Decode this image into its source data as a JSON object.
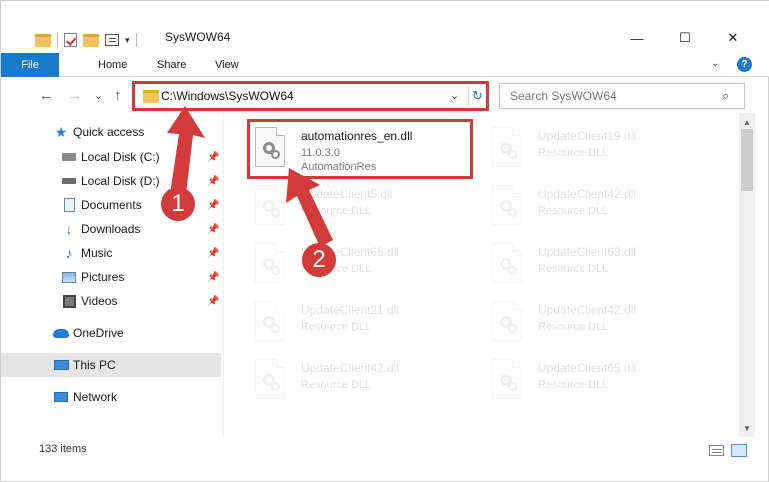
{
  "window": {
    "title": "SysWOW64",
    "minimize": "—",
    "maximize": "☐",
    "close": "✕"
  },
  "ribbon": {
    "tabs": [
      {
        "label": "File"
      },
      {
        "label": "Home"
      },
      {
        "label": "Share"
      },
      {
        "label": "View"
      }
    ],
    "help": "?"
  },
  "navigation": {
    "back": "←",
    "forward": "→",
    "recent": "⌄",
    "up": "↑"
  },
  "address": {
    "path": "C:\\Windows\\SysWOW64",
    "dropdown": "⌄",
    "refresh": "↻"
  },
  "search": {
    "placeholder": "Search SysWOW64",
    "icon": "search-icon"
  },
  "sidebar": {
    "items": [
      {
        "label": "Quick access",
        "icon": "star-icon"
      },
      {
        "label": "Local Disk (C:)",
        "icon": "drive-icon",
        "pinned": true
      },
      {
        "label": "Local Disk (D:)",
        "icon": "drive-icon",
        "pinned": true
      },
      {
        "label": "Documents",
        "icon": "documents-icon",
        "pinned": true
      },
      {
        "label": "Downloads",
        "icon": "download-icon",
        "pinned": true
      },
      {
        "label": "Music",
        "icon": "music-icon",
        "pinned": true
      },
      {
        "label": "Pictures",
        "icon": "pictures-icon",
        "pinned": true
      },
      {
        "label": "Videos",
        "icon": "videos-icon",
        "pinned": true
      },
      {
        "label": "OneDrive",
        "icon": "cloud-icon"
      },
      {
        "label": "This PC",
        "icon": "pc-icon",
        "selected": true
      },
      {
        "label": "Network",
        "icon": "network-icon"
      }
    ]
  },
  "files": {
    "highlighted": {
      "name": "automationres_en.dll",
      "version": "11.0.3.0",
      "description": "AutomationRes"
    },
    "faded": [
      {
        "name": "UpdateClient19.dll",
        "type": "Resource DLL"
      },
      {
        "name": "UpdateClient5.dll",
        "type": "Resource DLL"
      },
      {
        "name": "UpdateClient42.dll",
        "type": "Resource DLL"
      },
      {
        "name": "UpdateClient65.dll",
        "type": "Resource DLL"
      },
      {
        "name": "UpdateClient63.dll",
        "type": "Resource DLL"
      },
      {
        "name": "UpdateClient21.dll",
        "type": "Resource DLL"
      },
      {
        "name": "UpdateClient42.dll",
        "type": "Resource DLL"
      },
      {
        "name": "UpdateClient42.dll",
        "type": "Resource DLL"
      },
      {
        "name": "UpdateClient65.dll",
        "type": "Resource DLL"
      }
    ]
  },
  "status": {
    "count": "133 items"
  },
  "callouts": [
    {
      "number": "1"
    },
    {
      "number": "2"
    }
  ],
  "colors": {
    "accent": "#1979ca",
    "annotation": "#d33a3a"
  }
}
